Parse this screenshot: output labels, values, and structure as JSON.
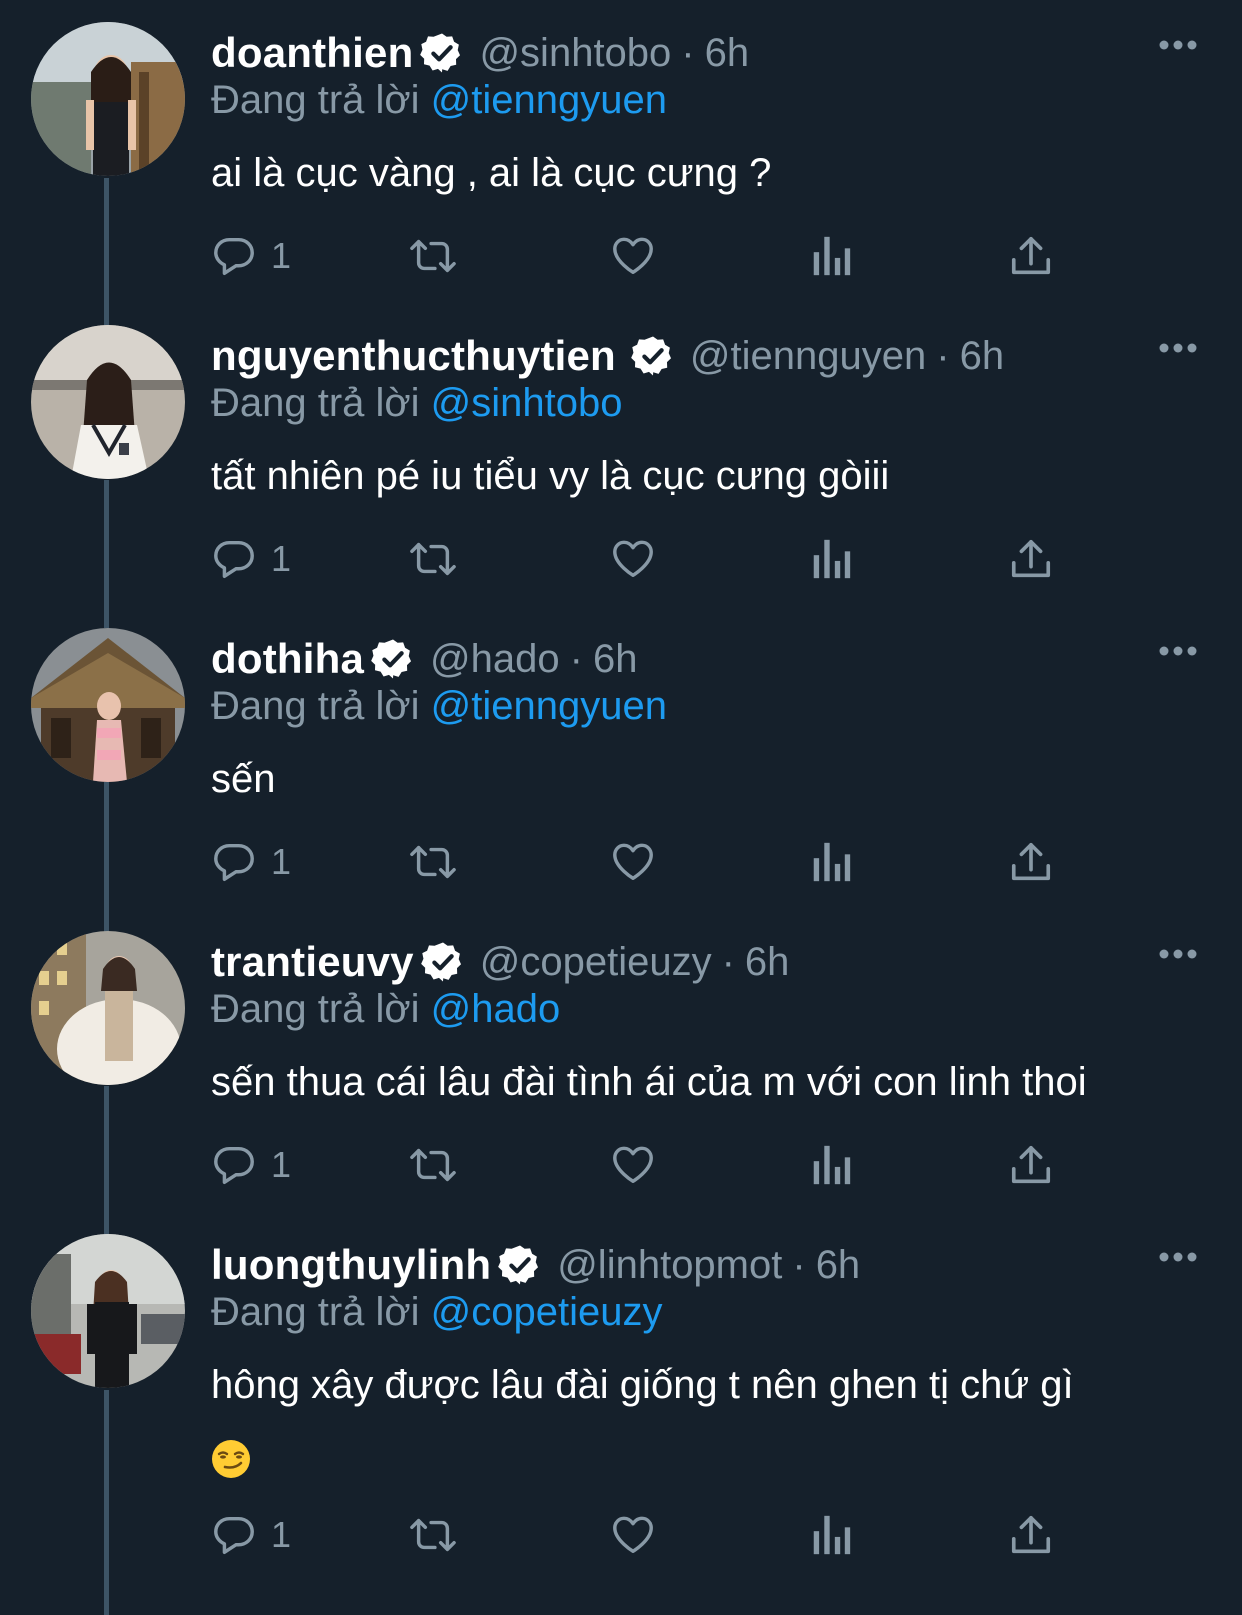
{
  "tweets": [
    {
      "name": "doanthien",
      "handle": "@sinhtobo",
      "time": "6h",
      "replying_prefix": "Đang trả lời",
      "replying_to": "@tienngyuen",
      "text": "ai là cục vàng , ai là cục cưng ?",
      "reply_count": "1"
    },
    {
      "name": "nguyenthucthuytien",
      "handle": "@tiennguyen",
      "time": "6h",
      "replying_prefix": "Đang trả lời",
      "replying_to": "@sinhtobo",
      "text": "tất nhiên pé iu tiểu vy là cục cưng gòiii",
      "reply_count": "1"
    },
    {
      "name": "dothiha",
      "handle": "@hado",
      "time": "6h",
      "replying_prefix": "Đang trả lời",
      "replying_to": "@tienngyuen",
      "text": "sến",
      "reply_count": "1"
    },
    {
      "name": "trantieuvy",
      "handle": "@copetieuzy",
      "time": "6h",
      "replying_prefix": "Đang trả lời",
      "replying_to": "@hado",
      "text": "sến thua cái lâu đài tình ái của m với con linh thoi",
      "reply_count": "1"
    },
    {
      "name": "luongthuylinh",
      "handle": "@linhtopmot",
      "time": "6h",
      "replying_prefix": "Đang trả lời",
      "replying_to": "@copetieuzy",
      "text": "hông xây được lâu đài giống t nên ghen tị chứ gì",
      "emoji": "smirk-emoji",
      "reply_count": "1"
    }
  ],
  "separator": "·",
  "colors": {
    "background": "#15202b",
    "secondary_text": "#8899a6",
    "accent": "#1d9bf0",
    "thread_line": "#3d5466"
  },
  "icons": [
    "verified-badge-icon",
    "more-options-icon",
    "reply-icon",
    "retweet-icon",
    "like-icon",
    "analytics-icon",
    "share-icon"
  ]
}
